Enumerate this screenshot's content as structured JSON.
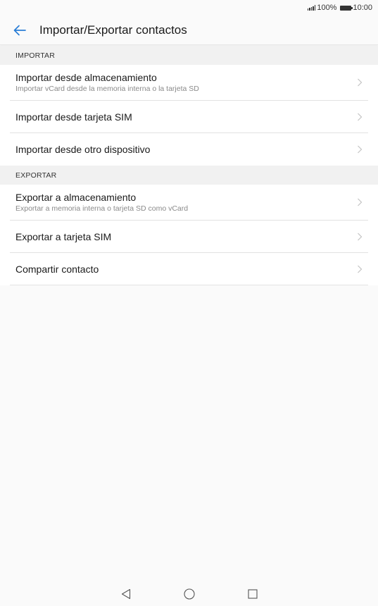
{
  "status_bar": {
    "battery_percent": "100%",
    "time": "10:00"
  },
  "header": {
    "title": "Importar/Exportar contactos",
    "back_icon": "arrow-left-icon",
    "accent_color": "#2a7ed6"
  },
  "sections": {
    "import": {
      "label": "IMPORTAR",
      "items": [
        {
          "title": "Importar desde almacenamiento",
          "subtitle": "Importar vCard desde la memoria interna o la tarjeta SD"
        },
        {
          "title": "Importar desde tarjeta SIM"
        },
        {
          "title": "Importar desde otro dispositivo"
        }
      ]
    },
    "export": {
      "label": "EXPORTAR",
      "items": [
        {
          "title": "Exportar a almacenamiento",
          "subtitle": "Exportar a memoria interna o tarjeta SD como vCard"
        },
        {
          "title": "Exportar a tarjeta SIM"
        },
        {
          "title": "Compartir contacto"
        }
      ]
    }
  },
  "nav_bar": {
    "back_icon": "triangle-back-icon",
    "home_icon": "circle-home-icon",
    "recents_icon": "square-recents-icon"
  }
}
